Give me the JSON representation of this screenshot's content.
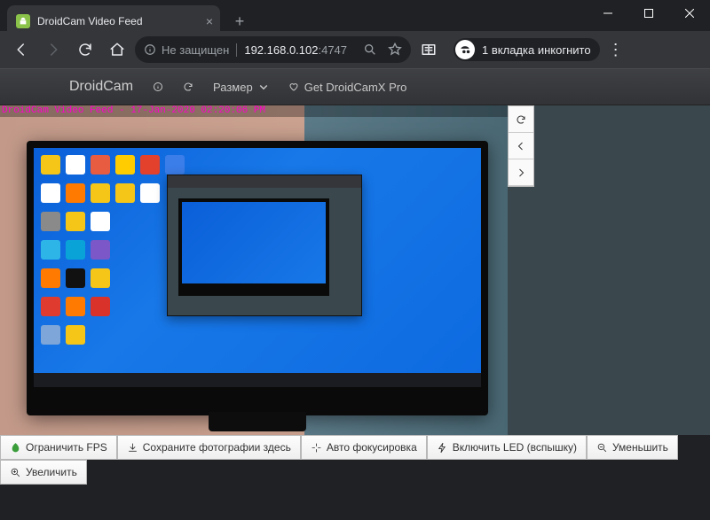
{
  "window": {
    "tab_title": "DroidCam Video Feed"
  },
  "browser": {
    "security_label": "Не защищен",
    "url_text": "192.168.0.102",
    "url_port": ":4747",
    "incognito_label": "1 вкладка инкогнито"
  },
  "app_header": {
    "brand": "DroidCam",
    "size_label": "Размер",
    "pro_label": "Get DroidCamX Pro"
  },
  "feed": {
    "overlay_text": "DroidCam Video Feed - 17-Jan-2020 02:20:06 PM"
  },
  "actions": {
    "limit_fps": "Ограничить FPS",
    "save_photos": "Сохраните фотографии здесь",
    "autofocus": "Авто фокусировка",
    "led_on": "Включить LED (вспышку)",
    "zoom_out": "Уменьшить",
    "zoom_in": "Увеличить"
  }
}
